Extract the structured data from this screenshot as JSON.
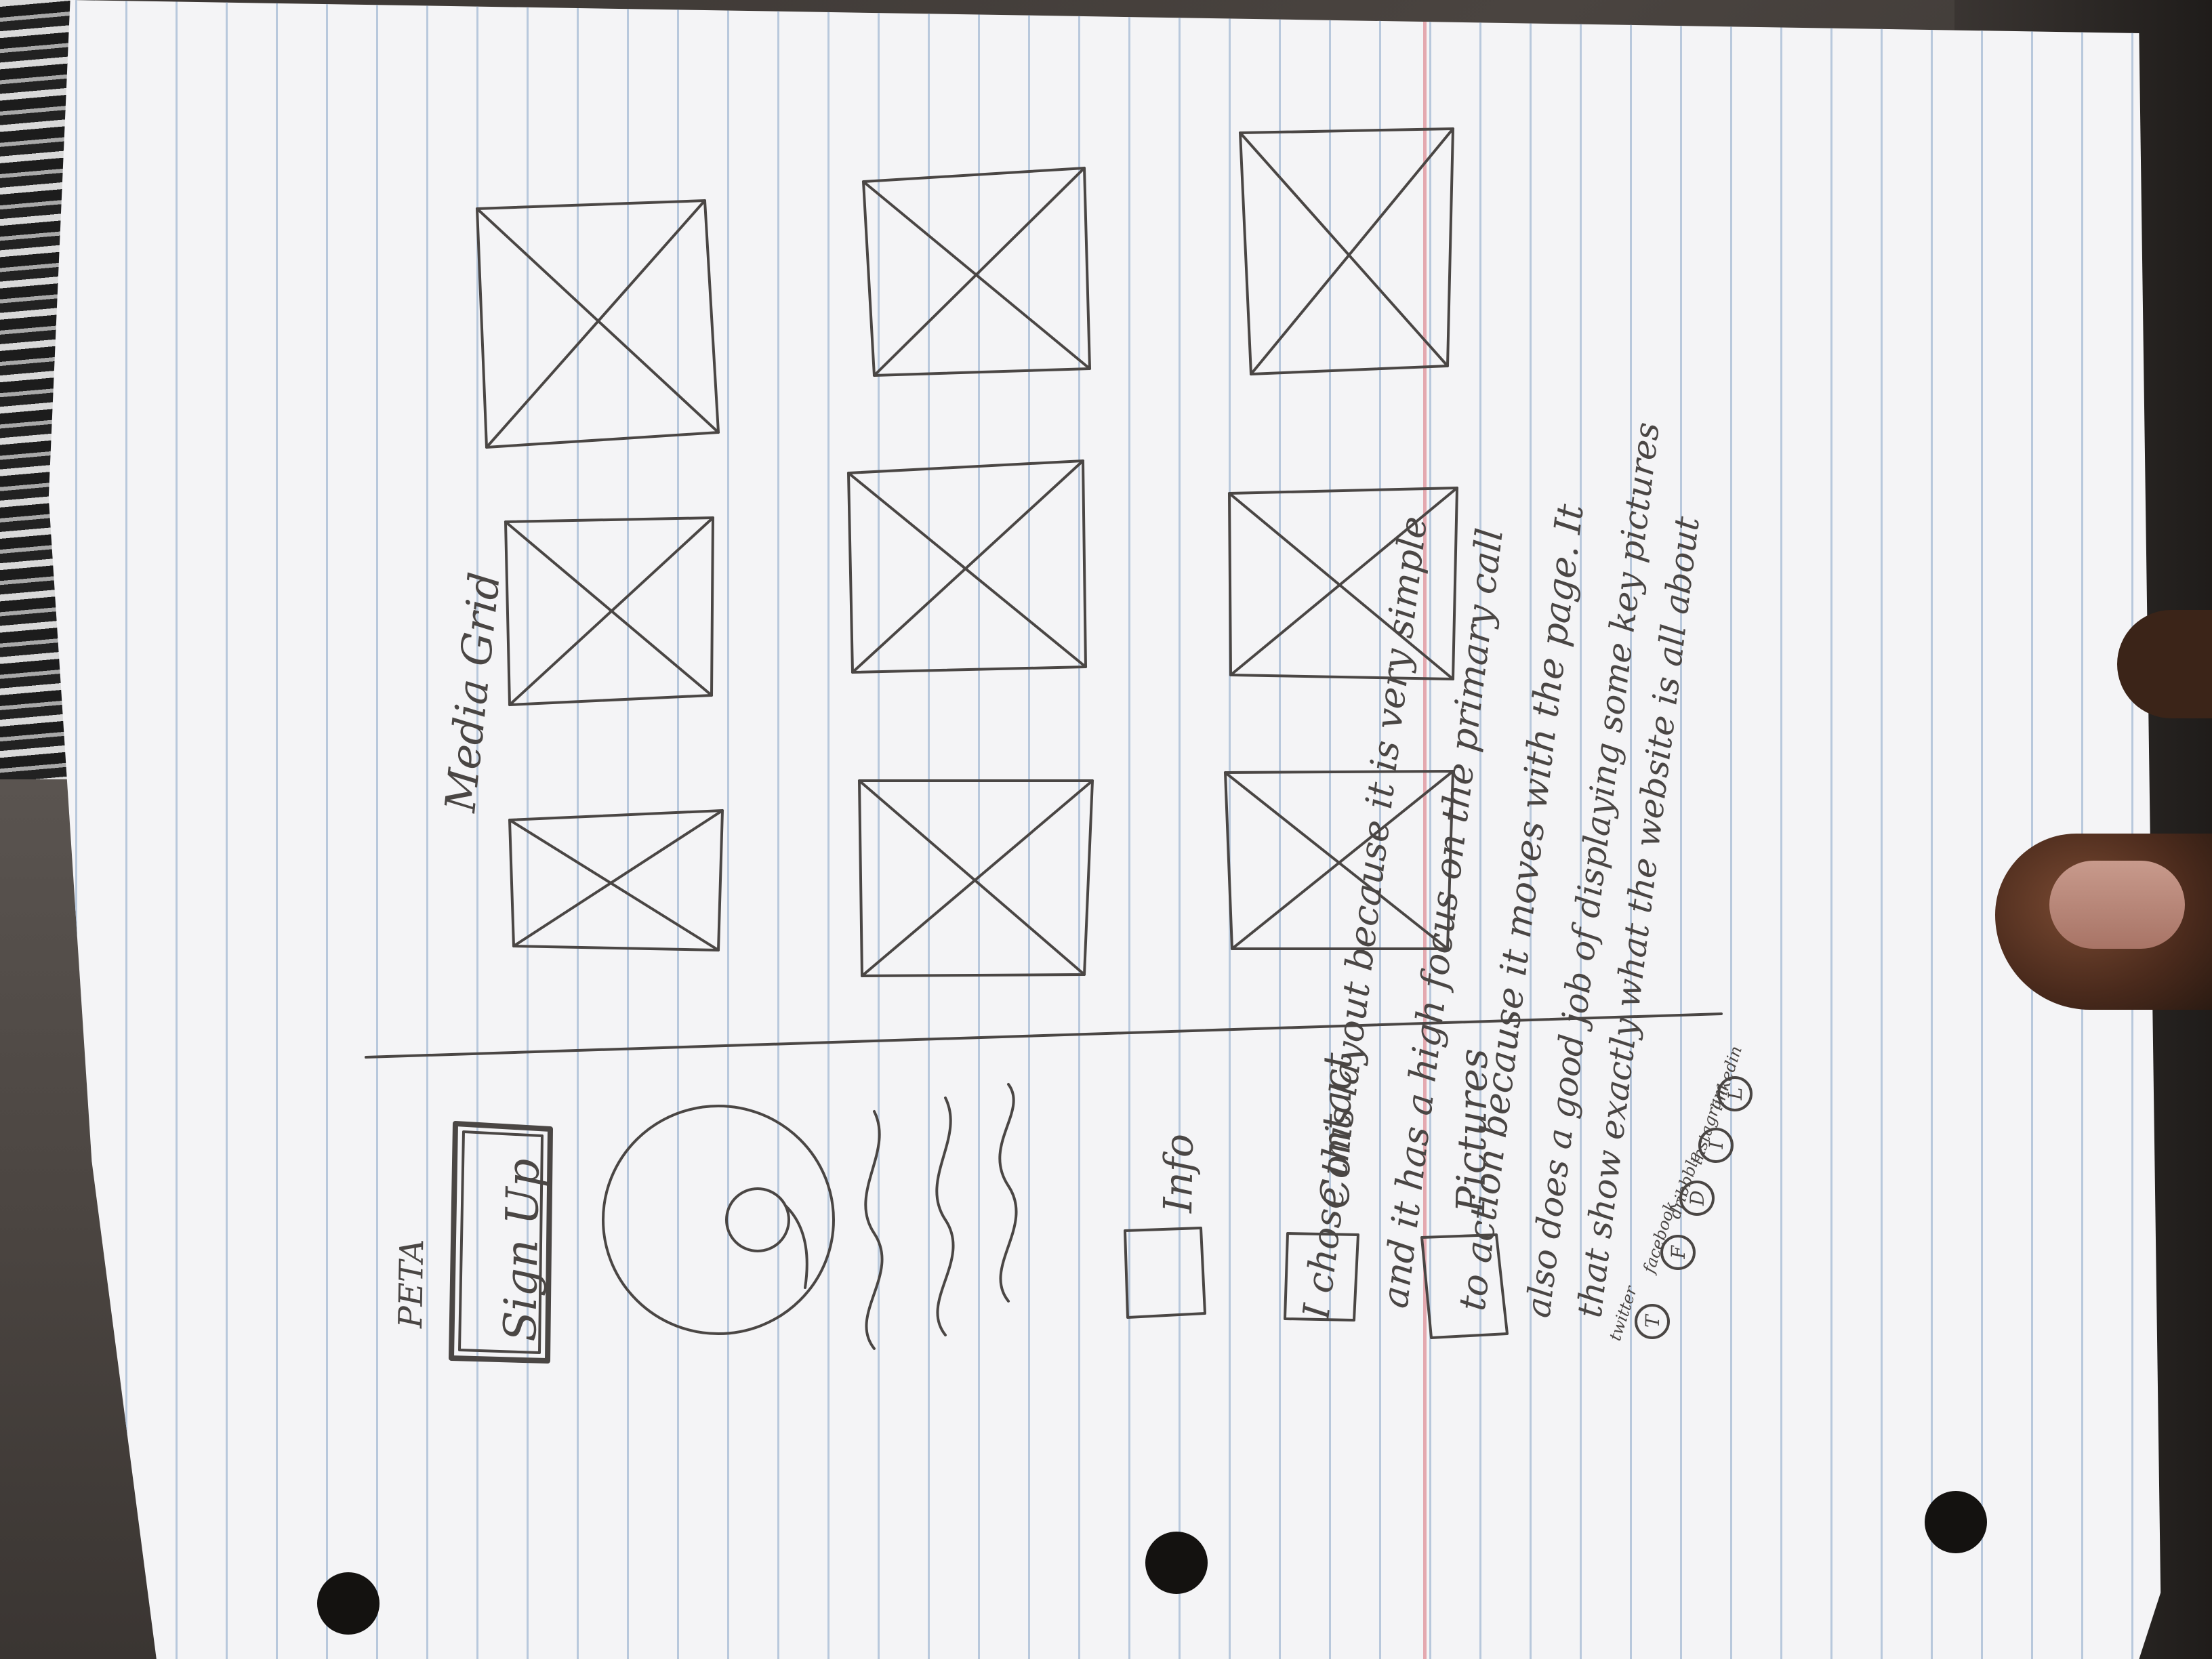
{
  "wireframe": {
    "brand": "PETA",
    "signup_label": "Sign Up",
    "media_heading": "Media Grid",
    "nav": [
      {
        "label": "Info"
      },
      {
        "label": "Contact"
      },
      {
        "label": "Pictures"
      }
    ],
    "social": {
      "labels": [
        "twitter",
        "facebook",
        "dribbble",
        "instagram",
        "linkedin"
      ],
      "icons": [
        "T",
        "F",
        "D",
        "I",
        "L"
      ]
    },
    "rationale_lines": [
      "I chose this layout because it is very simple",
      "and it has a high focus on the primary call",
      "to action because it moves with the page. It",
      "also does a good job of displaying some key pictures",
      "that show exactly what the website is all about"
    ]
  }
}
